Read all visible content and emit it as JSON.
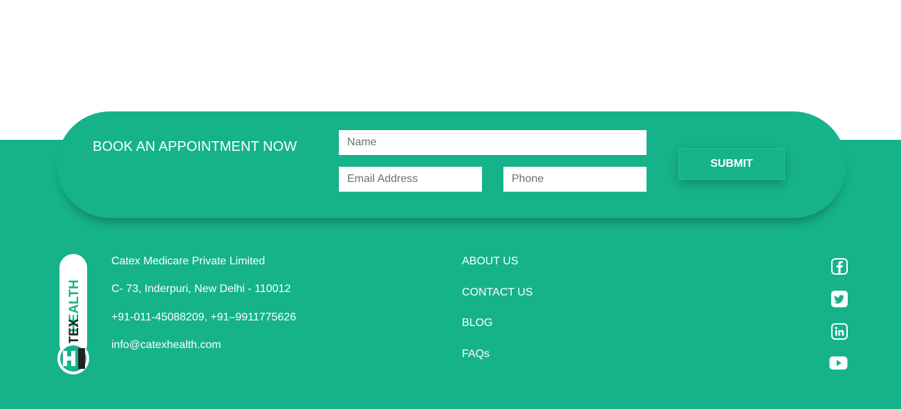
{
  "colors": {
    "brand_green": "#16b38a",
    "text": "#ffffff",
    "dark": "#222222"
  },
  "booking": {
    "title": "BOOK AN APPOINTMENT NOW",
    "name_placeholder": "Name",
    "email_placeholder": "Email Address",
    "phone_placeholder": "Phone",
    "submit_label": "SUBMIT"
  },
  "logo": {
    "text_catex": "CATEX",
    "text_health": "HEALTH"
  },
  "contact": {
    "company": "Catex Medicare Private Limited",
    "address": "C- 73, Inderpuri, New Delhi - 110012",
    "phones": "+91-011-45088209, +91–9911775626",
    "email": "info@catexhealth.com"
  },
  "nav": {
    "items": [
      {
        "label": "ABOUT US"
      },
      {
        "label": "CONTACT US"
      },
      {
        "label": "BLOG"
      },
      {
        "label": "FAQs"
      }
    ]
  },
  "social": {
    "icons": [
      "facebook-icon",
      "twitter-icon",
      "linkedin-icon",
      "youtube-icon"
    ]
  }
}
